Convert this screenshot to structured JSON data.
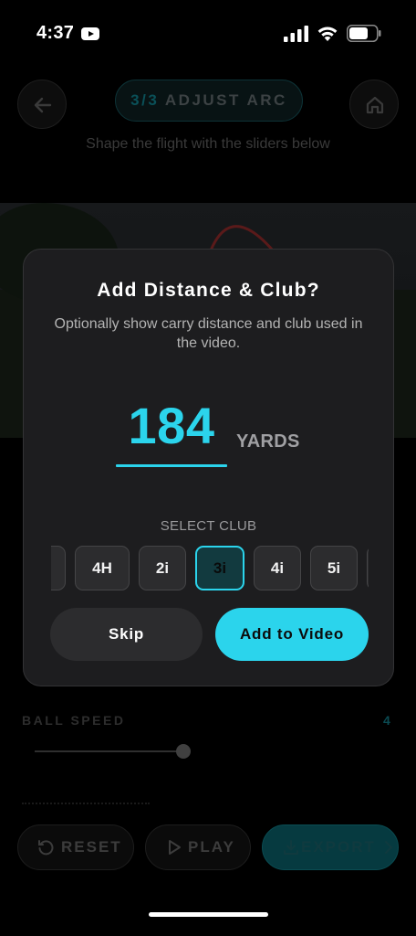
{
  "status_bar": {
    "time": "4:37",
    "icons": [
      "youtube-icon",
      "signal-icon",
      "wifi-icon",
      "battery-icon"
    ]
  },
  "header": {
    "step_number": "3/3",
    "step_title": "ADJUST ARC",
    "subtitle": "Shape the flight with the sliders below",
    "back_icon": "arrow-left-icon",
    "home_icon": "home-icon"
  },
  "controls": {
    "ball_speed_label": "BALL SPEED",
    "ball_speed_value": "4"
  },
  "actions": {
    "reset_label": "RESET",
    "play_label": "PLAY",
    "export_label": "EXPORT"
  },
  "modal": {
    "title": "Add Distance & Club?",
    "description": "Optionally show carry distance and club used in the video.",
    "distance_value": "184",
    "distance_unit": "YARDS",
    "select_club_label": "SELECT CLUB",
    "clubs": [
      "",
      "4H",
      "2i",
      "3i",
      "4i",
      "5i",
      ""
    ],
    "selected_club": "3i",
    "skip_label": "Skip",
    "add_label": "Add to Video"
  },
  "colors": {
    "accent": "#2BD4EC",
    "modal_bg": "#1D1D1F",
    "chip_bg": "#2C2C2E",
    "background": "#000000"
  }
}
